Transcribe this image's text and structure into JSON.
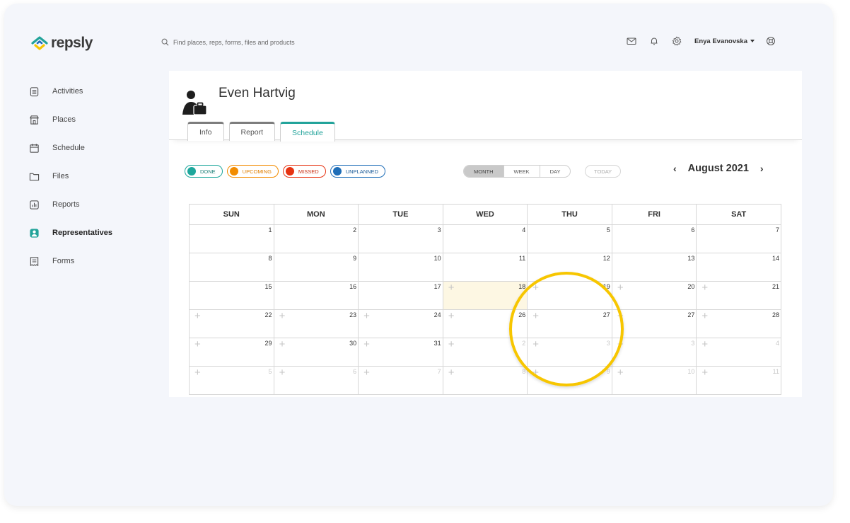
{
  "app": {
    "name": "repsly",
    "brand_colors": {
      "teal": "#22a39a",
      "blue": "#1f6eb8",
      "yellow": "#f7c600"
    }
  },
  "search": {
    "placeholder": "Find places, reps, forms, files and products"
  },
  "header": {
    "user_name": "Enya Evanovska",
    "icons": [
      "mail-icon",
      "bell-icon",
      "settings-icon",
      "help-icon"
    ]
  },
  "sidebar": {
    "items": [
      {
        "label": "Activities",
        "icon": "clipboard-icon",
        "active": false
      },
      {
        "label": "Places",
        "icon": "store-icon",
        "active": false
      },
      {
        "label": "Schedule",
        "icon": "calendar-icon",
        "active": false
      },
      {
        "label": "Files",
        "icon": "folder-icon",
        "active": false
      },
      {
        "label": "Reports",
        "icon": "chart-icon",
        "active": false
      },
      {
        "label": "Representatives",
        "icon": "person-icon",
        "active": true
      },
      {
        "label": "Forms",
        "icon": "form-icon",
        "active": false
      }
    ]
  },
  "profile": {
    "name": "Even Hartvig"
  },
  "tabs": [
    {
      "label": "Info",
      "active": false
    },
    {
      "label": "Report",
      "active": false
    },
    {
      "label": "Schedule",
      "active": true
    }
  ],
  "legend": [
    {
      "label": "DONE",
      "color": "#1ea79c"
    },
    {
      "label": "UPCOMING",
      "color": "#f28c00"
    },
    {
      "label": "MISSED",
      "color": "#e63312"
    },
    {
      "label": "UNPLANNED",
      "color": "#1f6eb8"
    }
  ],
  "views": [
    {
      "label": "MONTH",
      "selected": true
    },
    {
      "label": "WEEK",
      "selected": false
    },
    {
      "label": "DAY",
      "selected": false
    }
  ],
  "today_label": "TODAY",
  "month_label": "August 2021",
  "calendar": {
    "weekdays": [
      "SUN",
      "MON",
      "TUE",
      "WED",
      "THU",
      "FRI",
      "SAT"
    ],
    "weeks": [
      [
        {
          "d": "1"
        },
        {
          "d": "2"
        },
        {
          "d": "3"
        },
        {
          "d": "4"
        },
        {
          "d": "5"
        },
        {
          "d": "6"
        },
        {
          "d": "7"
        }
      ],
      [
        {
          "d": "8"
        },
        {
          "d": "9"
        },
        {
          "d": "10"
        },
        {
          "d": "11"
        },
        {
          "d": "12"
        },
        {
          "d": "13"
        },
        {
          "d": "14"
        }
      ],
      [
        {
          "d": "15"
        },
        {
          "d": "16"
        },
        {
          "d": "17"
        },
        {
          "d": "18",
          "plus": true,
          "today": true
        },
        {
          "d": "19",
          "plus": true
        },
        {
          "d": "20",
          "plus": true
        },
        {
          "d": "21",
          "plus": true
        }
      ],
      [
        {
          "d": "22",
          "plus": true
        },
        {
          "d": "23",
          "plus": true
        },
        {
          "d": "24",
          "plus": true
        },
        {
          "d": "26",
          "plus": true
        },
        {
          "d": "27",
          "plus": true
        },
        {
          "d": "27",
          "plus": true
        },
        {
          "d": "28",
          "plus": true
        }
      ],
      [
        {
          "d": "29",
          "plus": true
        },
        {
          "d": "30",
          "plus": true
        },
        {
          "d": "31",
          "plus": true
        },
        {
          "d": "2",
          "plus": true,
          "other": true
        },
        {
          "d": "3",
          "plus": true,
          "other": true
        },
        {
          "d": "3",
          "plus": true,
          "other": true
        },
        {
          "d": "4",
          "plus": true,
          "other": true
        }
      ],
      [
        {
          "d": "5",
          "plus": true,
          "other": true
        },
        {
          "d": "6",
          "plus": true,
          "other": true
        },
        {
          "d": "7",
          "plus": true,
          "other": true
        },
        {
          "d": "8",
          "plus": true,
          "other": true
        },
        {
          "d": "9",
          "plus": true,
          "other": true
        },
        {
          "d": "10",
          "plus": true,
          "other": true
        },
        {
          "d": "11",
          "plus": true,
          "other": true
        }
      ]
    ]
  }
}
